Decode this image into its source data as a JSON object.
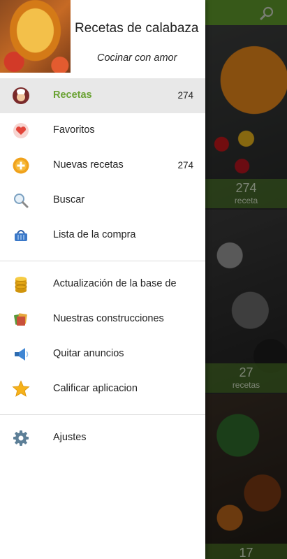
{
  "header": {
    "title": "Recetas de calabaza",
    "subtitle": "Cocinar con amor"
  },
  "menu_group1": [
    {
      "label": "Recetas",
      "count": "274",
      "icon": "chef-icon",
      "selected": true
    },
    {
      "label": "Favoritos",
      "count": "",
      "icon": "heart-icon"
    },
    {
      "label": "Nuevas recetas",
      "count": "274",
      "icon": "plus-circle-icon"
    },
    {
      "label": "Buscar",
      "count": "",
      "icon": "magnifier-icon"
    },
    {
      "label": "Lista de la compra",
      "count": "",
      "icon": "basket-icon"
    }
  ],
  "menu_group2": [
    {
      "label": "Actualización de la base de",
      "icon": "database-icon"
    },
    {
      "label": "Nuestras construcciones",
      "icon": "apps-icon"
    },
    {
      "label": "Quitar anuncios",
      "icon": "megaphone-icon"
    },
    {
      "label": "Calificar aplicacion",
      "icon": "star-icon"
    }
  ],
  "menu_group3": [
    {
      "label": "Ajustes",
      "icon": "gear-icon"
    }
  ],
  "background_cards": [
    {
      "count": "274",
      "label": "receta"
    },
    {
      "count": "27",
      "label": "recetas"
    },
    {
      "count": "17",
      "label": ""
    }
  ],
  "colors": {
    "accent": "#6aa233",
    "toolbar": "#5f9a2b",
    "selected_bg": "#e8e8e8"
  }
}
